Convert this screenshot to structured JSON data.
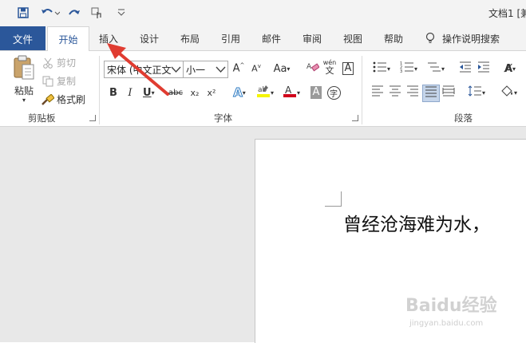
{
  "title_bar": {
    "doc_title": "文档1 [兼"
  },
  "tabs": {
    "file": "文件",
    "home": "开始",
    "insert": "插入",
    "design": "设计",
    "layout": "布局",
    "references": "引用",
    "mailings": "邮件",
    "review": "审阅",
    "view": "视图",
    "help": "帮助",
    "tell_me": "操作说明搜索"
  },
  "clipboard": {
    "paste": "粘贴",
    "cut": "剪切",
    "copy": "复制",
    "format_painter": "格式刷",
    "group_label": "剪贴板"
  },
  "font": {
    "font_name": "宋体 (中文正文",
    "font_size": "小一",
    "group_label": "字体",
    "bold": "B",
    "italic": "I",
    "underline": "U",
    "strike": "abc",
    "subscript": "x₂",
    "superscript": "x²",
    "case": "Aa",
    "phonetic": "wén",
    "char_border": "A",
    "char_shading": "A",
    "enclosed": "字"
  },
  "paragraph": {
    "group_label": "段落"
  },
  "document": {
    "text": "曾经沧海难为水，"
  },
  "watermark": {
    "text": "Baidu经验",
    "sub": "jingyan.baidu.com"
  },
  "colors": {
    "accent": "#2b579a",
    "arrow": "#e03c31",
    "highlight": "#f5f500",
    "font_color": "#d0021b"
  }
}
